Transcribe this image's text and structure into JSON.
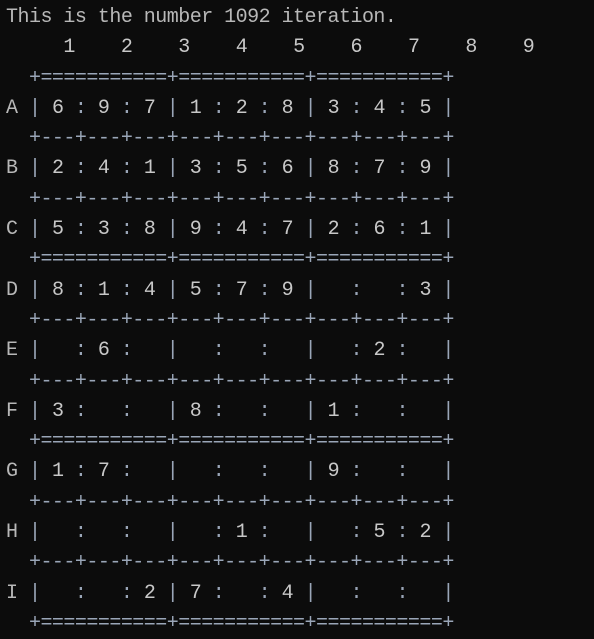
{
  "title": "This is the number 1092 iteration.",
  "column_labels": [
    "1",
    "2",
    "3",
    "4",
    "5",
    "6",
    "7",
    "8",
    "9"
  ],
  "row_labels": [
    "A",
    "B",
    "C",
    "D",
    "E",
    "F",
    "G",
    "H",
    "I"
  ],
  "grid": [
    [
      "6",
      "9",
      "7",
      "1",
      "2",
      "8",
      "3",
      "4",
      "5"
    ],
    [
      "2",
      "4",
      "1",
      "3",
      "5",
      "6",
      "8",
      "7",
      "9"
    ],
    [
      "5",
      "3",
      "8",
      "9",
      "4",
      "7",
      "2",
      "6",
      "1"
    ],
    [
      "8",
      "1",
      "4",
      "5",
      "7",
      "9",
      "",
      "",
      "3"
    ],
    [
      "",
      "6",
      "",
      "",
      "",
      "",
      "",
      "2",
      ""
    ],
    [
      "3",
      "",
      "",
      "8",
      "",
      "",
      "1",
      "",
      ""
    ],
    [
      "1",
      "7",
      "",
      "",
      "",
      "",
      "9",
      "",
      ""
    ],
    [
      "",
      "",
      "",
      "",
      "1",
      "",
      "",
      "5",
      "2"
    ],
    [
      "",
      "",
      "2",
      "7",
      "",
      "4",
      "",
      "",
      ""
    ]
  ]
}
